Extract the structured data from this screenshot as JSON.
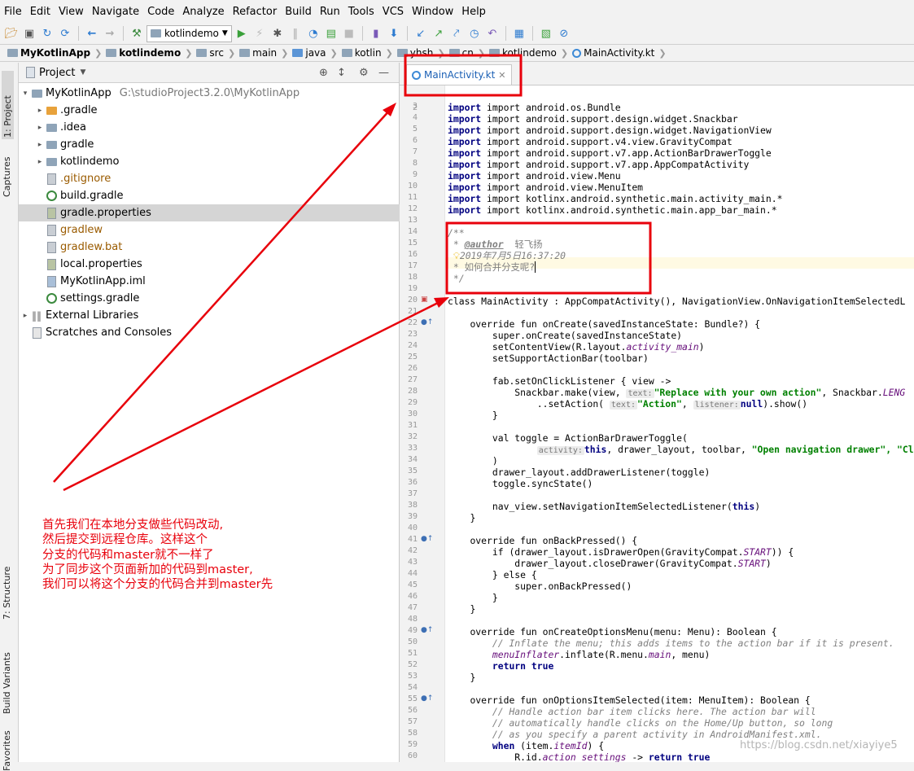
{
  "menu": [
    "File",
    "Edit",
    "View",
    "Navigate",
    "Code",
    "Analyze",
    "Refactor",
    "Build",
    "Run",
    "Tools",
    "VCS",
    "Window",
    "Help"
  ],
  "toolbar": {
    "run_config": "kotlindemo"
  },
  "breadcrumbs": [
    "MyKotlinApp",
    "kotlindemo",
    "src",
    "main",
    "java",
    "kotlin",
    "yhsh",
    "cn",
    "kotlindemo",
    "MainActivity.kt"
  ],
  "left_stripe": {
    "project": "1: Project",
    "captures": "Captures",
    "structure": "7: Structure",
    "build_variants": "Build Variants",
    "favorites": "Favorites"
  },
  "project_panel": {
    "view_label": "Project",
    "root": {
      "name": "MyKotlinApp",
      "path": "G:\\studioProject3.2.0\\MyKotlinApp"
    },
    "items": [
      {
        "name": ".gradle"
      },
      {
        "name": ".idea"
      },
      {
        "name": "gradle"
      },
      {
        "name": "kotlindemo"
      },
      {
        "name": ".gitignore"
      },
      {
        "name": "build.gradle"
      },
      {
        "name": "gradle.properties"
      },
      {
        "name": "gradlew"
      },
      {
        "name": "gradlew.bat"
      },
      {
        "name": "local.properties"
      },
      {
        "name": "MyKotlinApp.iml"
      },
      {
        "name": "settings.gradle"
      },
      {
        "name": "External Libraries"
      },
      {
        "name": "Scratches and Consoles"
      }
    ]
  },
  "editor": {
    "tab_label": "MainActivity.kt",
    "code": {
      "l3": "import android.os.Bundle",
      "l4": "import android.support.design.widget.Snackbar",
      "l5": "import android.support.design.widget.NavigationView",
      "l6": "import android.support.v4.view.GravityCompat",
      "l7": "import android.support.v7.app.ActionBarDrawerToggle",
      "l8": "import android.support.v7.app.AppCompatActivity",
      "l9": "import android.view.Menu",
      "l10": "import android.view.MenuItem",
      "l11": "import kotlinx.android.synthetic.main.activity_main.*",
      "l12": "import kotlinx.android.synthetic.main.app_bar_main.*",
      "l14": "/**",
      "l15_tag": "@author",
      "l15_name": "轻飞扬",
      "l16": "2019年7月5日16:37:20",
      "l17": "* 如何合并分支呢?",
      "l18": "*/",
      "l20": "class MainActivity : AppCompatActivity(), NavigationView.OnNavigationItemSelectedL",
      "l22": "override fun onCreate(savedInstanceState: Bundle?) {",
      "l23": "super.onCreate(savedInstanceState)",
      "l24a": "setContentView(R.layout.",
      "l24b": "activity_main",
      "l24c": ")",
      "l25": "setSupportActionBar(toolbar)",
      "l27": "fab.setOnClickListener { view ->",
      "l28a": "Snackbar.make(view,",
      "l28h": "text:",
      "l28s": "\"Replace with your own action\"",
      "l28b": ", Snackbar.",
      "l28c": "LENG",
      "l29a": ".setAction(",
      "l29h1": "text:",
      "l29s": "\"Action\"",
      "l29h2": "listener:",
      "l29b": "null",
      "l29c": ").show()",
      "l30": "}",
      "l32": "val toggle = ActionBarDrawerToggle(",
      "l33h": "activity:",
      "l33a": "this",
      "l33b": ", drawer_layout, toolbar, ",
      "l33s1": "\"Open navigation drawer\"",
      "l33s2": ", \"Close",
      "l34": ")",
      "l35": "drawer_layout.addDrawerListener(toggle)",
      "l36": "toggle.syncState()",
      "l38a": "nav_view.setNavigationItemSelectedListener(",
      "l38b": "this",
      "l38c": ")",
      "l39": "}",
      "l41": "override fun onBackPressed() {",
      "l42a": "if (drawer_layout.isDrawerOpen(GravityCompat.",
      "l42b": "START",
      "l42c": ")) {",
      "l43a": "drawer_layout.closeDrawer(GravityCompat.",
      "l43b": "START",
      "l43c": ")",
      "l44": "} else {",
      "l45": "super.onBackPressed()",
      "l46": "}",
      "l47": "}",
      "l49": "override fun onCreateOptionsMenu(menu: Menu): Boolean {",
      "l50": "// Inflate the menu; this adds items to the action bar if it is present.",
      "l51a": "menuInflater",
      "l51b": ".inflate(R.menu.",
      "l51c": "main",
      "l51d": ", menu)",
      "l52": "return true",
      "l53": "}",
      "l55": "override fun onOptionsItemSelected(item: MenuItem): Boolean {",
      "l56": "// Handle action bar item clicks here. The action bar will",
      "l57": "// automatically handle clicks on the Home/Up button, so long",
      "l58": "// as you specify a parent activity in AndroidManifest.xml.",
      "l59a": "when",
      "l59b": " (item.",
      "l59c": "itemId",
      "l59d": ") {",
      "l60a": "R.id.",
      "l60b": "action_settings",
      "l60c": " -> ",
      "l60d": "return true"
    }
  },
  "annotation": {
    "lines": [
      "首先我们在本地分支做些代码改动,",
      "然后提交到远程仓库。这样这个",
      "分支的代码和master就不一样了",
      "为了同步这个页面新加的代码到master,",
      "我们可以将这个分支的代码合并到master先"
    ],
    "color": "#e8000b"
  },
  "watermark": "https://blog.csdn.net/xiayiye5"
}
